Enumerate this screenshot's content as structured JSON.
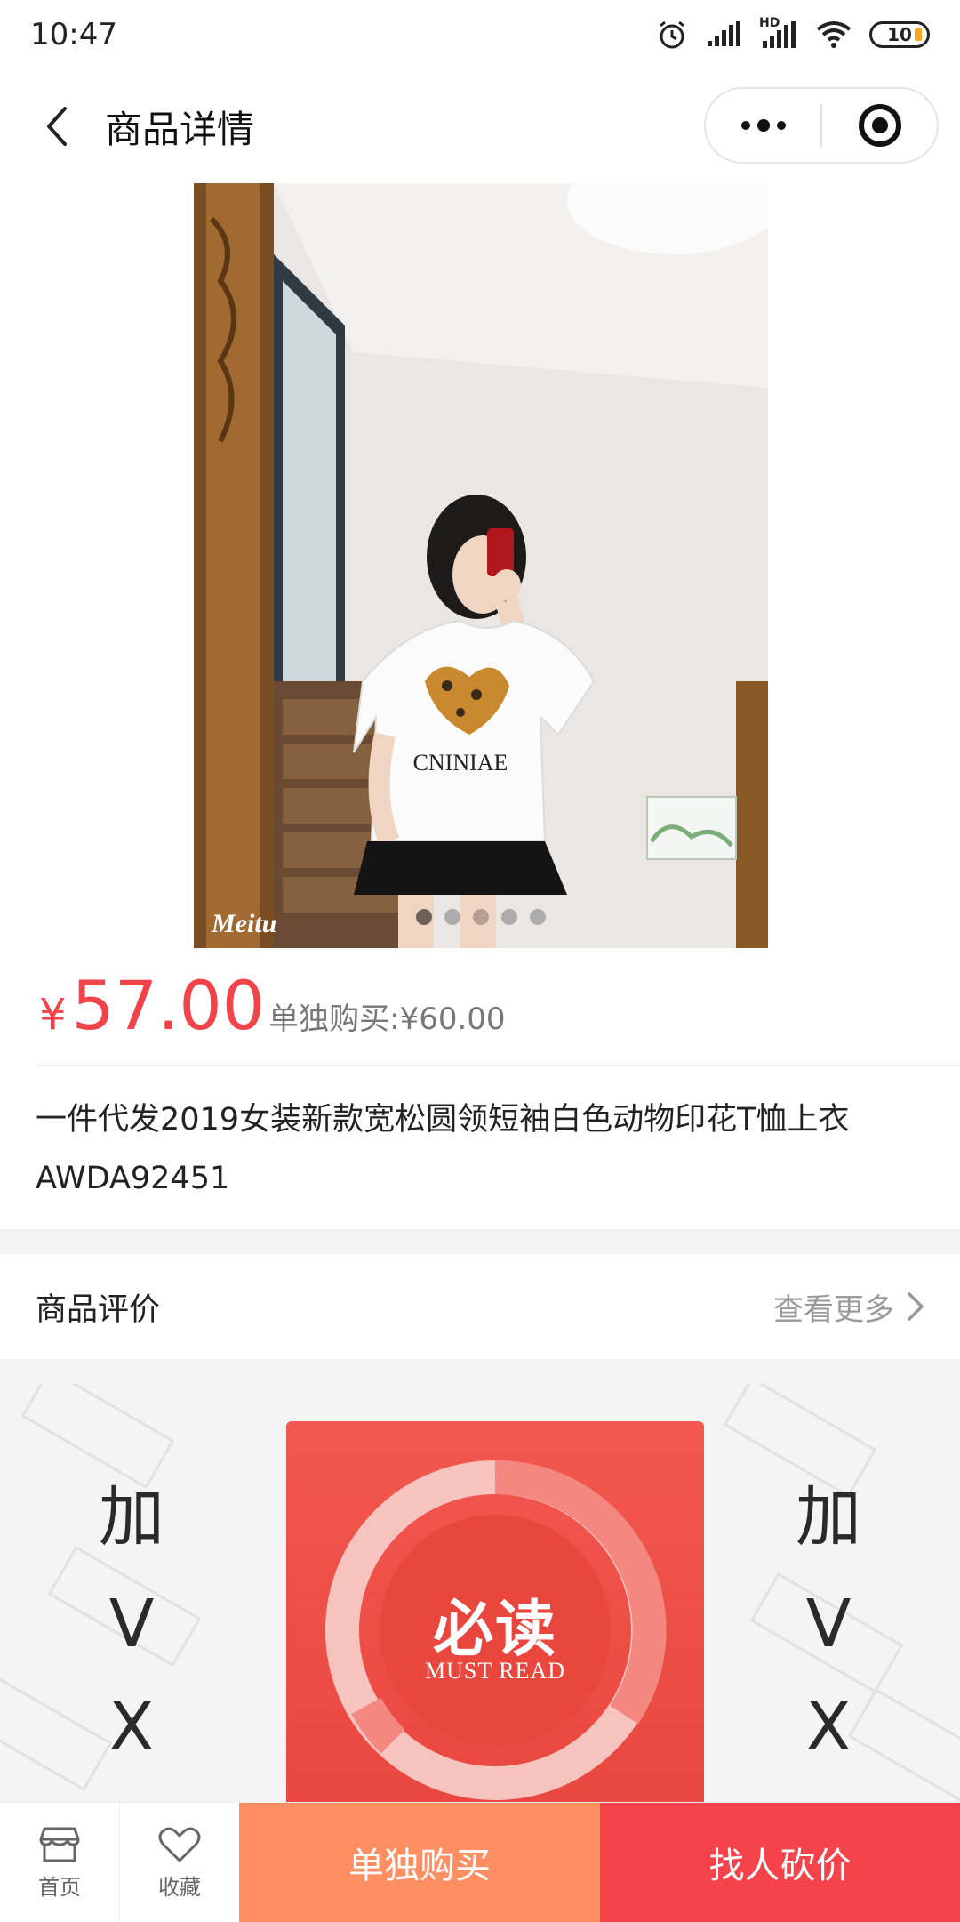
{
  "status_bar": {
    "time": "10:47",
    "battery": "10",
    "network_label": "HD"
  },
  "nav": {
    "title": "商品详情"
  },
  "gallery": {
    "watermark": "Meitu",
    "shirt_print": "CNINIAE",
    "slide_count": 5,
    "active_slide": 1
  },
  "price": {
    "symbol": "¥",
    "group_price": "57.00",
    "alone_price_text": "单独购买:¥60.00"
  },
  "product": {
    "title": "一件代发2019女装新款宽松圆领短袖白色动物印花T恤上衣AWDA92451"
  },
  "reviews": {
    "title": "商品评价",
    "more_label": "查看更多"
  },
  "promo": {
    "left_chars": [
      "加",
      "V",
      "X"
    ],
    "right_chars": [
      "加",
      "V",
      "X"
    ],
    "badge_main": "必读",
    "badge_sub": "MUST READ"
  },
  "bottom_bar": {
    "home_label": "首页",
    "favorite_label": "收藏",
    "buy_alone_label": "单独购买",
    "bargain_label": "找人砍价"
  },
  "colors": {
    "price_red": "#f2434a",
    "buy_alone_orange": "#ff8f63",
    "bargain_red": "#f4434a"
  }
}
